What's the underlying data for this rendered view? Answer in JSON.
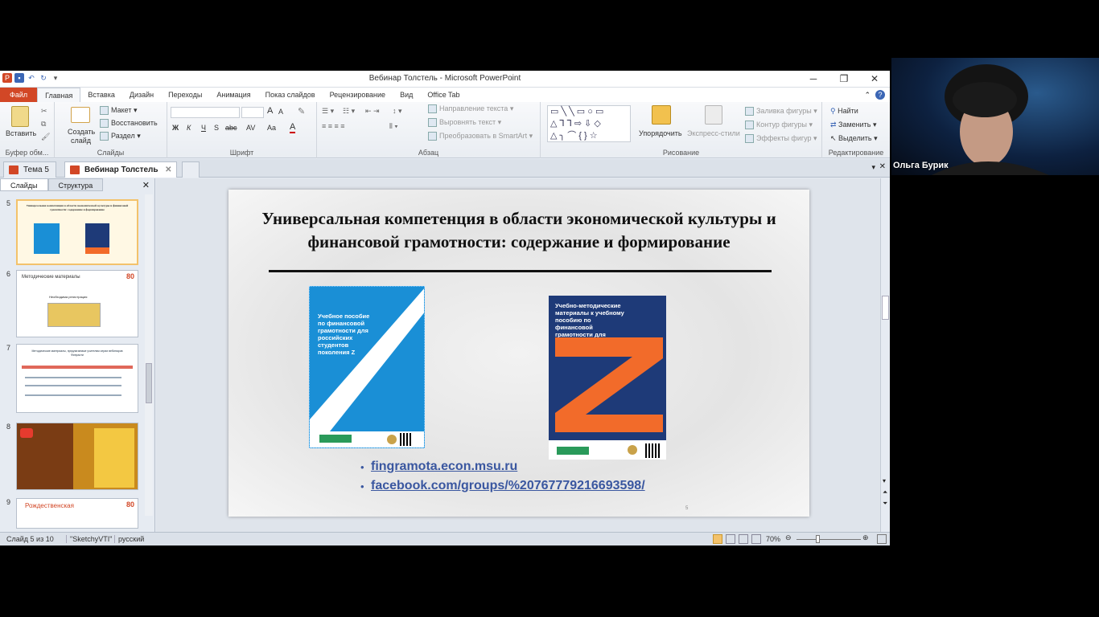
{
  "window": {
    "title": "Вебинар  Толстель  -  Microsoft PowerPoint"
  },
  "ribbon_tabs": [
    {
      "label": "Файл",
      "kind": "file"
    },
    {
      "label": "Главная",
      "kind": "active"
    },
    {
      "label": "Вставка"
    },
    {
      "label": "Дизайн"
    },
    {
      "label": "Переходы"
    },
    {
      "label": "Анимация"
    },
    {
      "label": "Показ слайдов"
    },
    {
      "label": "Рецензирование"
    },
    {
      "label": "Вид"
    },
    {
      "label": "Office Tab"
    }
  ],
  "ribbon": {
    "clipboard": {
      "paste": "Вставить",
      "label": "Буфер обм..."
    },
    "slides": {
      "create": "Создать",
      "create2": "слайд",
      "layout": "Макет",
      "reset": "Восстановить",
      "section": "Раздел",
      "label": "Слайды"
    },
    "font": {
      "label": "Шрифт",
      "bold": "Ж",
      "italic": "К",
      "underline": "Ч",
      "strike": "S",
      "shadow": "abc",
      "spacing": "AV",
      "case": "Aa",
      "color": "A",
      "grow": "A",
      "shrink": "A"
    },
    "paragraph": {
      "label": "Абзац",
      "dir": "Направление текста",
      "align": "Выровнять текст",
      "smartart": "Преобразовать в SmartArt"
    },
    "drawing": {
      "label": "Рисование",
      "arrange": "Упорядочить",
      "quick": "Экспресс-стили",
      "fill": "Заливка фигуры",
      "outline": "Контур фигуры",
      "effects": "Эффекты фигур"
    },
    "editing": {
      "label": "Редактирование",
      "find": "Найти",
      "replace": "Заменить",
      "select": "Выделить"
    }
  },
  "doc_tabs": [
    {
      "label": "Тема 5",
      "active": false
    },
    {
      "label": "Вебинар  Толстель",
      "active": true
    }
  ],
  "panel_tabs": {
    "slides": "Слайды",
    "outline": "Структура"
  },
  "thumbnails": [
    {
      "num": "5",
      "title": "Универсальная компетенция в области экономической культуры и финансовой грамотности: содержание и формирование"
    },
    {
      "num": "6",
      "title": "Методические материалы",
      "sub": "Необходима регистрация"
    },
    {
      "num": "7",
      "title": "Методические материалы, предлагаемые учителям серии вебинаров Финрасти"
    },
    {
      "num": "8",
      "title": ""
    },
    {
      "num": "9",
      "title": "Рождественская"
    }
  ],
  "slide": {
    "title": "Универсальная  компетенция в области экономической культуры и финансовой грамотности: содержание и формирование",
    "book1": {
      "text": "Учебное пособие по финансовой грамотности для российских студентов поколения Z",
      "highlight": "по финансовой грамотности"
    },
    "book2": {
      "text": "Учебно-методические материалы к учебному пособию по финансовой грамотности для российских студентов поколения Z"
    },
    "links": [
      "fingramota.econ.msu.ru",
      "facebook.com/groups/%20767779216693598/"
    ],
    "page": "5"
  },
  "status": {
    "slide": "Слайд 5 из 10",
    "theme": "\"SketchyVTI\"",
    "lang": "русский",
    "zoom": "70%"
  },
  "webcam": {
    "name": "Ольга Бурик"
  },
  "colors": {
    "file_tab": "#d24726",
    "book_blue": "#1a8fd6",
    "book_navy": "#1e3a78",
    "book_orange": "#f26b2a"
  }
}
